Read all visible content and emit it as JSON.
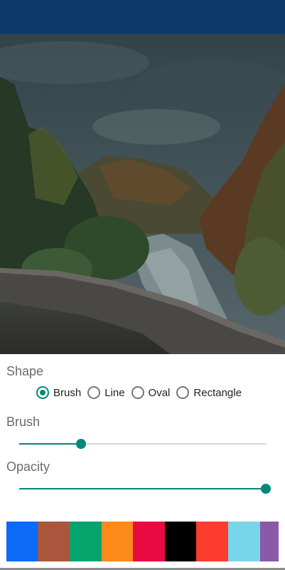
{
  "shape": {
    "label": "Shape",
    "options": [
      {
        "label": "Brush",
        "checked": true
      },
      {
        "label": "Line",
        "checked": false
      },
      {
        "label": "Oval",
        "checked": false
      },
      {
        "label": "Rectangle",
        "checked": false
      }
    ]
  },
  "brush": {
    "label": "Brush",
    "value_fraction": 0.25
  },
  "opacity": {
    "label": "Opacity",
    "value_fraction": 1.0
  },
  "accent_color": "#00897b",
  "appbar_color": "#0d3a68",
  "palette": [
    {
      "name": "blue",
      "color": "#0b6af8"
    },
    {
      "name": "brown",
      "color": "#a9563c"
    },
    {
      "name": "green",
      "color": "#05a46c"
    },
    {
      "name": "orange",
      "color": "#fb8a1b"
    },
    {
      "name": "crimson",
      "color": "#ea0a42"
    },
    {
      "name": "black",
      "color": "#000000"
    },
    {
      "name": "red",
      "color": "#fd3c30"
    },
    {
      "name": "light-blue",
      "color": "#79d5ea"
    },
    {
      "name": "purple",
      "color": "#8a59a9"
    }
  ]
}
